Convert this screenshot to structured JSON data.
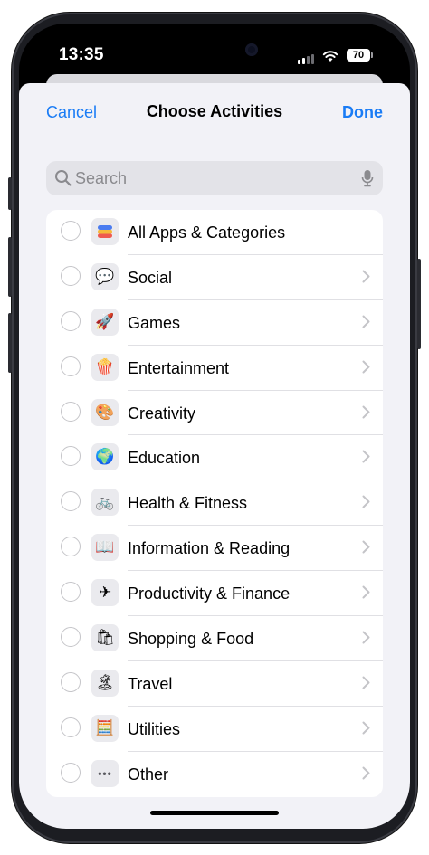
{
  "status_bar": {
    "time": "13:35",
    "battery": "70"
  },
  "nav": {
    "cancel": "Cancel",
    "title": "Choose Activities",
    "done": "Done"
  },
  "search": {
    "placeholder": "Search",
    "value": ""
  },
  "items": [
    {
      "label": "All Apps & Categories",
      "icon": "stack-icon",
      "glyph": "",
      "chevron": false
    },
    {
      "label": "Social",
      "icon": "heart-bubble-icon",
      "glyph": "💬",
      "chevron": true
    },
    {
      "label": "Games",
      "icon": "rocket-icon",
      "glyph": "🚀",
      "chevron": true
    },
    {
      "label": "Entertainment",
      "icon": "popcorn-icon",
      "glyph": "🍿",
      "chevron": true
    },
    {
      "label": "Creativity",
      "icon": "palette-icon",
      "glyph": "🎨",
      "chevron": true
    },
    {
      "label": "Education",
      "icon": "globe-icon",
      "glyph": "🌍",
      "chevron": true
    },
    {
      "label": "Health & Fitness",
      "icon": "bicycle-icon",
      "glyph": "🚲",
      "chevron": true
    },
    {
      "label": "Information & Reading",
      "icon": "book-icon",
      "glyph": "📖",
      "chevron": true
    },
    {
      "label": "Productivity & Finance",
      "icon": "paper-plane-icon",
      "glyph": "✈",
      "chevron": true
    },
    {
      "label": "Shopping & Food",
      "icon": "shopping-bag-icon",
      "glyph": "🛍",
      "chevron": true
    },
    {
      "label": "Travel",
      "icon": "island-icon",
      "glyph": "🏝",
      "chevron": true
    },
    {
      "label": "Utilities",
      "icon": "calculator-icon",
      "glyph": "🧮",
      "chevron": true
    },
    {
      "label": "Other",
      "icon": "ellipsis-icon",
      "glyph": "•••",
      "chevron": true
    }
  ],
  "colors": {
    "accent": "#1a7cf5",
    "sheet_bg": "#f2f2f7",
    "frame": "#1c1d22"
  }
}
